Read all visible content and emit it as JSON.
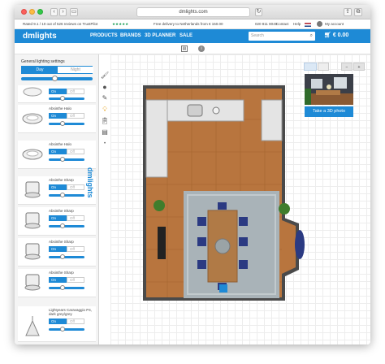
{
  "browser": {
    "url": "dmlights.com"
  },
  "infobar": {
    "rating": "Rated 9.1 / 10 out of 526 reviews on TrustPilot",
    "stars": "★★★★★",
    "delivery": "Free delivery to Netherlands from € 150.00",
    "phone": "020 811 8040",
    "contact": "Contact",
    "help": "Help",
    "account": "My account"
  },
  "nav": {
    "logo": "dmlights",
    "items": [
      "PRODUCTS",
      "BRANDS",
      "3D PLANNER",
      "SALE"
    ],
    "search_placeholder": "Search",
    "cart": "€ 0.00"
  },
  "sidebar": {
    "title": "General lighting settings",
    "tabs": [
      "Day",
      "Night"
    ],
    "on_label": "On",
    "off_label": "Off",
    "items": [
      {
        "name": ""
      },
      {
        "name": "Absinthe Halo"
      },
      {
        "name": "Absinthe Halo"
      },
      {
        "name": "Absinthe Sharp"
      },
      {
        "name": "Absinthe Sharp"
      },
      {
        "name": "Absinthe Sharp"
      },
      {
        "name": "Absinthe Sharp"
      },
      {
        "name": "Lightyears Caravaggio P4, dark grey/grey"
      }
    ]
  },
  "brand_vertical": "dmlights",
  "view": {
    "mode_2d": "",
    "mode_3d": "",
    "zoom_out": "−",
    "zoom_in": "+"
  },
  "photo_button": "Take a 3D photo",
  "colors": {
    "brand": "#1e8ad6",
    "floor": "#b8753e",
    "rug": "#a9b3b8",
    "chairs": "#2b3a82",
    "table": "#b07a46"
  }
}
